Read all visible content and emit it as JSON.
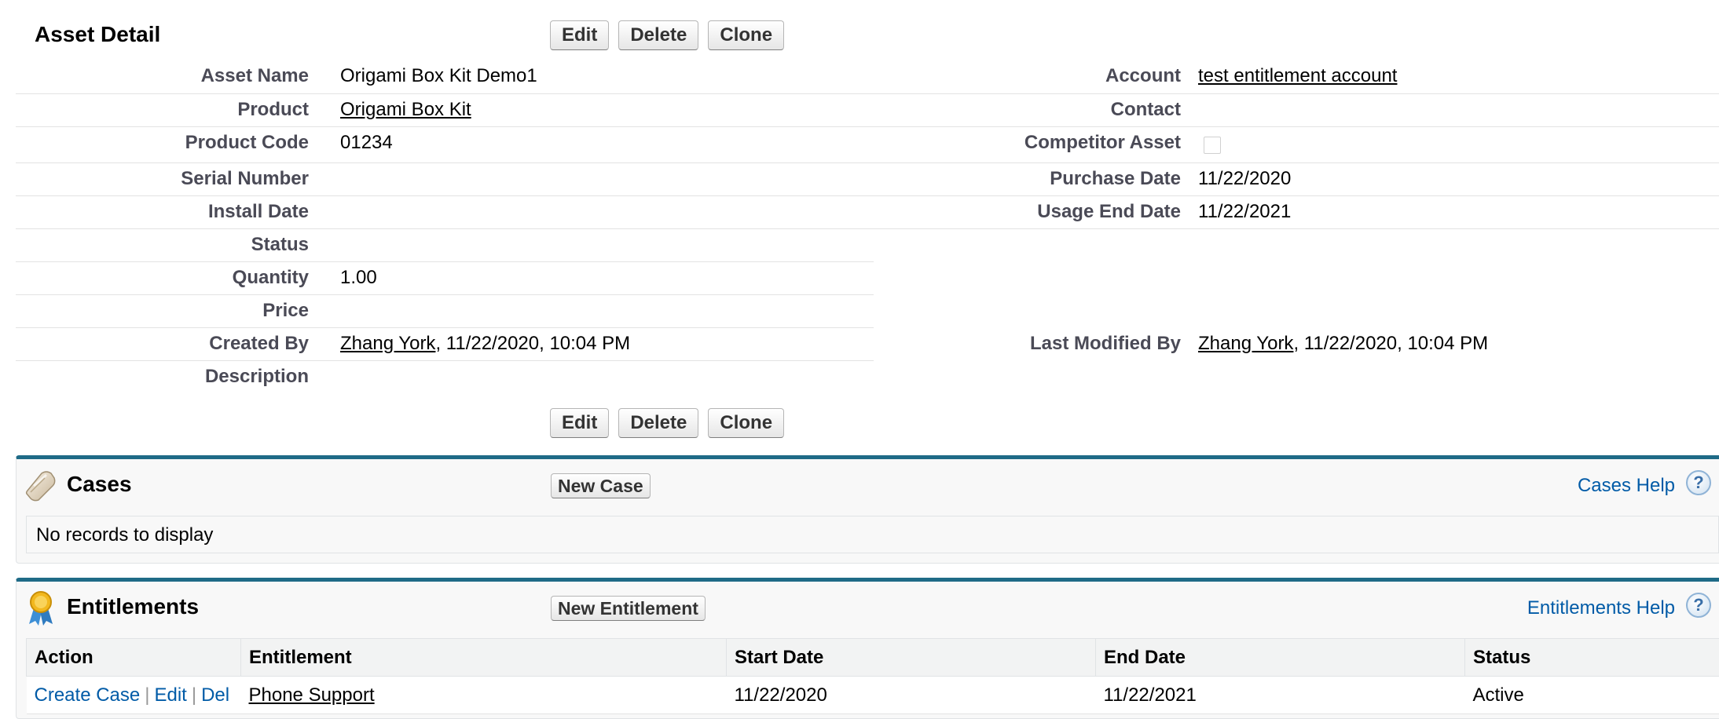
{
  "detail": {
    "title": "Asset Detail",
    "buttons": {
      "edit": "Edit",
      "delete": "Delete",
      "clone": "Clone"
    },
    "fields": {
      "asset_name": {
        "label": "Asset Name",
        "value": "Origami Box Kit Demo1"
      },
      "product": {
        "label": "Product",
        "value": "Origami Box Kit"
      },
      "product_code": {
        "label": "Product Code",
        "value": "01234"
      },
      "serial_number": {
        "label": "Serial Number",
        "value": ""
      },
      "install_date": {
        "label": "Install Date",
        "value": ""
      },
      "status": {
        "label": "Status",
        "value": ""
      },
      "quantity": {
        "label": "Quantity",
        "value": "1.00"
      },
      "price": {
        "label": "Price",
        "value": ""
      },
      "created_by": {
        "label": "Created By",
        "user": "Zhang York",
        "date": ", 11/22/2020, 10:04 PM"
      },
      "description": {
        "label": "Description",
        "value": ""
      },
      "account": {
        "label": "Account",
        "value": "test entitlement account"
      },
      "contact": {
        "label": "Contact",
        "value": ""
      },
      "competitor_asset": {
        "label": "Competitor Asset",
        "checked": false
      },
      "purchase_date": {
        "label": "Purchase Date",
        "value": "11/22/2020"
      },
      "usage_end_date": {
        "label": "Usage End Date",
        "value": "11/22/2021"
      },
      "last_modified_by": {
        "label": "Last Modified By",
        "user": "Zhang York",
        "date": ", 11/22/2020, 10:04 PM"
      }
    }
  },
  "cases": {
    "title": "Cases",
    "new_button": "New Case",
    "help": "Cases Help",
    "help_glyph": "?",
    "empty": "No records to display"
  },
  "entitlements": {
    "title": "Entitlements",
    "new_button": "New Entitlement",
    "help": "Entitlements Help",
    "help_glyph": "?",
    "columns": [
      "Action",
      "Entitlement",
      "Start Date",
      "End Date",
      "Status"
    ],
    "rows": [
      {
        "actions": [
          "Create Case",
          "Edit",
          "Del"
        ],
        "separator": "|",
        "entitlement": "Phone Support",
        "start_date": "11/22/2020",
        "end_date": "11/22/2021",
        "status": "Active"
      }
    ]
  },
  "icons": {
    "cases": "cases-icon",
    "entitlements": "ribbon-award-icon",
    "help": "help-icon"
  },
  "colors": {
    "link": "#015ba7",
    "section_border": "#1f6b87",
    "label": "#4a4a56"
  }
}
